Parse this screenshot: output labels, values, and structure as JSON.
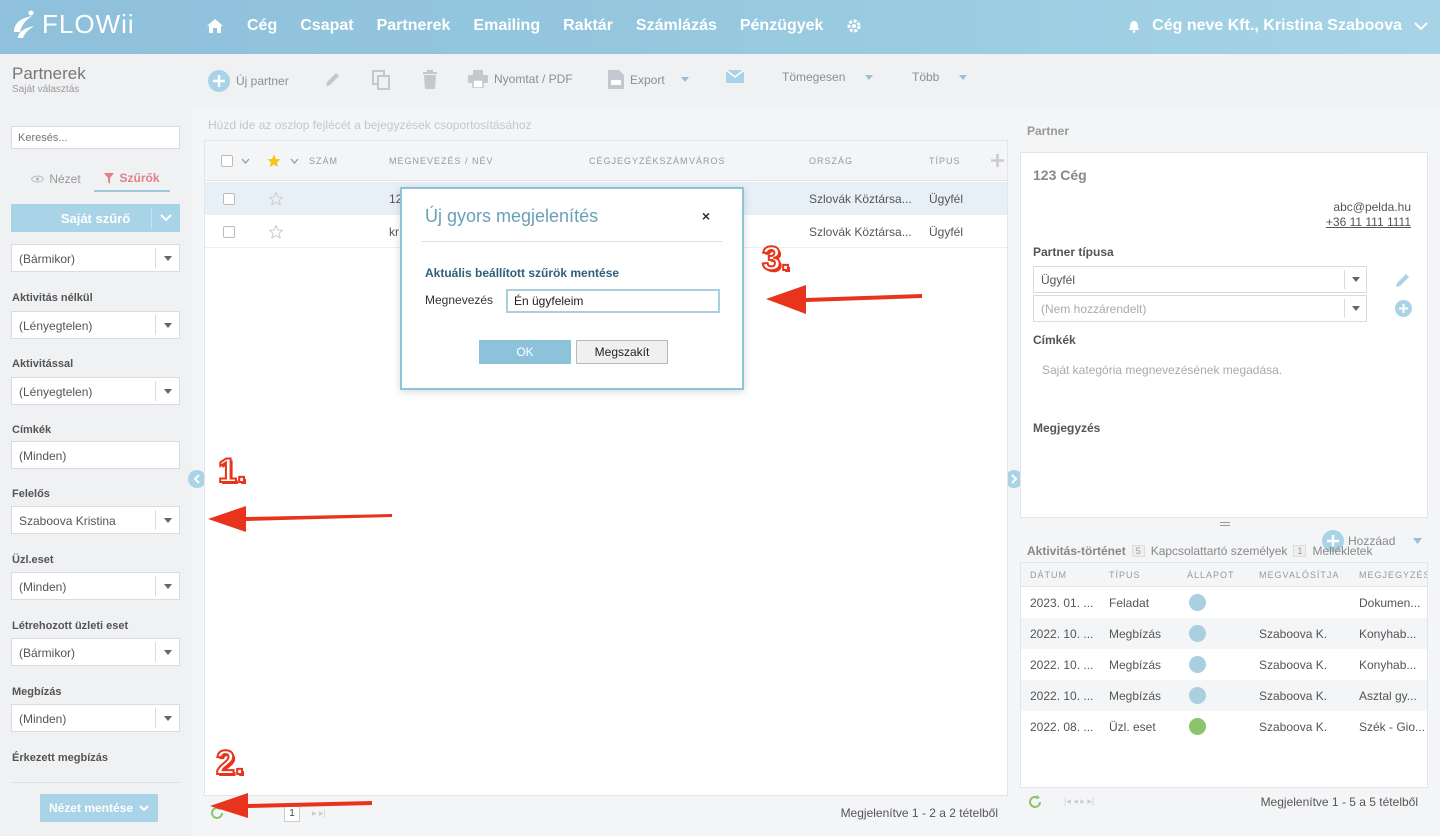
{
  "app": {
    "logo_text": "FLOWii"
  },
  "nav": {
    "items": [
      "Cég",
      "Csapat",
      "Partnerek",
      "Emailing",
      "Raktár",
      "Számlázás",
      "Pénzügyek"
    ]
  },
  "user": {
    "name": "Cég neve Kft., Kristina Szaboova"
  },
  "page": {
    "title": "Partnerek",
    "subtitle": "Saját választás"
  },
  "toolbar": {
    "new_partner": "Új partner",
    "print": "Nyomtat / PDF",
    "export": "Export",
    "bulk": "Tömegesen",
    "more": "Több"
  },
  "sidebar": {
    "search_placeholder": "Keresés...",
    "tab_view": "Nézet",
    "tab_filters": "Szűrők",
    "own_filter": "Saját szűrő",
    "first_select": "(Bármikor)",
    "filters": [
      {
        "label": "Aktivitás nélkül",
        "value": "(Lényegtelen)"
      },
      {
        "label": "Aktivitással",
        "value": "(Lényegtelen)"
      },
      {
        "label": "Címkék",
        "value": "(Minden)"
      },
      {
        "label": "Felelős",
        "value": "Szaboova Kristina"
      },
      {
        "label": "Üzl.eset",
        "value": "(Minden)"
      },
      {
        "label": "Létrehozott üzleti eset",
        "value": "(Bármikor)"
      },
      {
        "label": "Megbízás",
        "value": "(Minden)"
      }
    ],
    "last_label": "Érkezett megbízás",
    "save_view": "Nézet mentése"
  },
  "grid": {
    "group_hint": "Húzd ide az oszlop fejlécét a bejegyzések csoportosításához",
    "headers": [
      "Szám",
      "Megnevezés / Név",
      "Cégjegyzékszám",
      "Város",
      "Ország",
      "Típus"
    ],
    "rows": [
      {
        "name": "12",
        "country": "Szlovák Köztársa...",
        "type": "Ügyfél"
      },
      {
        "name": "kr",
        "country": "Szlovák Köztársa...",
        "type": "Ügyfél"
      }
    ],
    "page_number": "1",
    "footer": "Megjelenítve 1 - 2 a 2 tételből"
  },
  "partner": {
    "section_title": "Partner",
    "name": "123 Cég",
    "email": "abc@pelda.hu",
    "phone": "+36 11 111 1111",
    "type_label": "Partner típusa",
    "type_value": "Ügyfél",
    "type_placeholder": "(Nem hozzárendelt)",
    "tags_label": "Címkék",
    "tags_hint": "Saját kategória megnevezésének megadása.",
    "note_label": "Megjegyzés",
    "add_label": "Hozzáad"
  },
  "activity": {
    "tabs": [
      {
        "label": "Aktivitás-történet",
        "count": "5"
      },
      {
        "label": "Kapcsolattartó személyek",
        "count": "1"
      },
      {
        "label": "Mellékletek",
        "count": ""
      }
    ],
    "headers": [
      "Dátum",
      "Típus",
      "Állapot",
      "Megvalósítja",
      "Megjegyzés"
    ],
    "rows": [
      {
        "date": "2023. 01. ...",
        "type": "Feladat",
        "status": "person",
        "owner": "",
        "note": "Dokumen..."
      },
      {
        "date": "2022. 10. ...",
        "type": "Megbízás",
        "status": "hourglass",
        "owner": "Szaboova K.",
        "note": "Konyhab..."
      },
      {
        "date": "2022. 10. ...",
        "type": "Megbízás",
        "status": "hourglass",
        "owner": "Szaboova K.",
        "note": "Konyhab..."
      },
      {
        "date": "2022. 10. ...",
        "type": "Megbízás",
        "status": "hourglass",
        "owner": "Szaboova K.",
        "note": "Asztal gy..."
      },
      {
        "date": "2022. 08. ...",
        "type": "Üzl. eset",
        "status": "done",
        "owner": "Szaboova K.",
        "note": "Szék - Gio..."
      }
    ],
    "footer": "Megjelenítve 1 - 5 a 5 tételből"
  },
  "modal": {
    "title": "Új gyors megjelenítés",
    "close": "×",
    "subtitle": "Aktuális beállított szűrök mentése",
    "name_label": "Megnevezés",
    "name_value": "Én ügyfeleim",
    "ok": "OK",
    "cancel": "Megszakít"
  },
  "annotations": [
    "1.",
    "2.",
    "3."
  ],
  "colors": {
    "accent": "#8ec4d9",
    "arrow": "#e8341c",
    "filter_active": "#e0808a"
  }
}
